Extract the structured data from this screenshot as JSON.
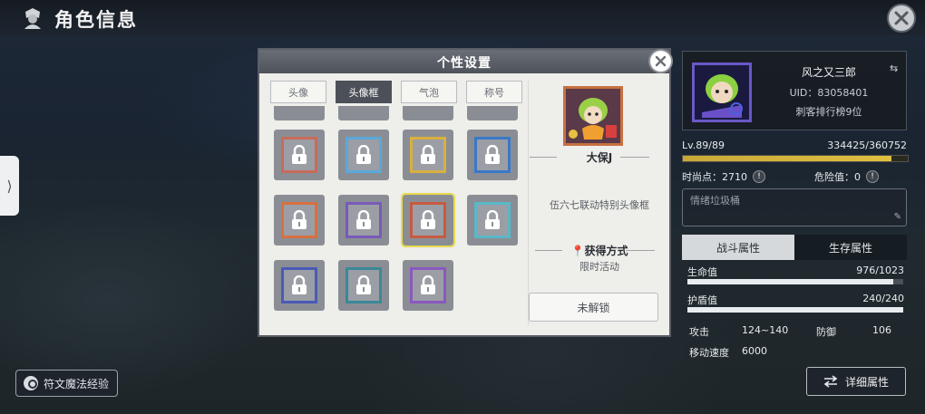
{
  "header": {
    "title": "角色信息",
    "icon": "character-icon",
    "close_icon": "close-icon"
  },
  "left_tab": {
    "glyph": "⟩"
  },
  "rune_button": {
    "label": "符文魔法经验",
    "icon": "rune-icon"
  },
  "modal": {
    "title": "个性设置",
    "tabs": [
      {
        "label": "头像",
        "active": false
      },
      {
        "label": "头像框",
        "active": true
      },
      {
        "label": "气泡",
        "active": false
      },
      {
        "label": "称号",
        "active": false
      }
    ],
    "frame_colors": [
      "#c86a5a",
      "#5aa8d8",
      "#d8b040",
      "#3a78c8",
      "#d87040",
      "#7a5ab8",
      "#c85a40",
      "#5ab8c8",
      "#4a5ab8",
      "#3a8898",
      "#8a58c0"
    ],
    "selected_index": 6,
    "detail": {
      "name": "大保J",
      "description": "伍六七联动特别头像框",
      "obtain_title": "获得方式",
      "obtain_value": "限时活动",
      "unlock_button": "未解锁"
    }
  },
  "profile": {
    "name": "风之又三郎",
    "uid": "UID：83058401",
    "rank": "刺客排行榜9位",
    "level": "Lv.89/89",
    "exp_text": "334425/360752",
    "exp_fraction": 0.927,
    "time_points_label": "时尚点：2710",
    "danger_label": "危险值：0",
    "signature_placeholder": "情绪垃圾桶"
  },
  "stats_tabs": [
    {
      "label": "战斗属性",
      "active": true
    },
    {
      "label": "生存属性",
      "active": false
    }
  ],
  "stats": {
    "hp_label": "生命值",
    "hp_value": "976/1023",
    "hp_fraction": 0.954,
    "shield_label": "护盾值",
    "shield_value": "240/240",
    "shield_fraction": 1.0,
    "attack_label": "攻击",
    "attack_value": "124~140",
    "defense_label": "防御",
    "defense_value": "106",
    "speed_label": "移动速度",
    "speed_value": "6000"
  },
  "detail_button": {
    "label": "详细属性",
    "icon": "swap-arrows-icon"
  }
}
